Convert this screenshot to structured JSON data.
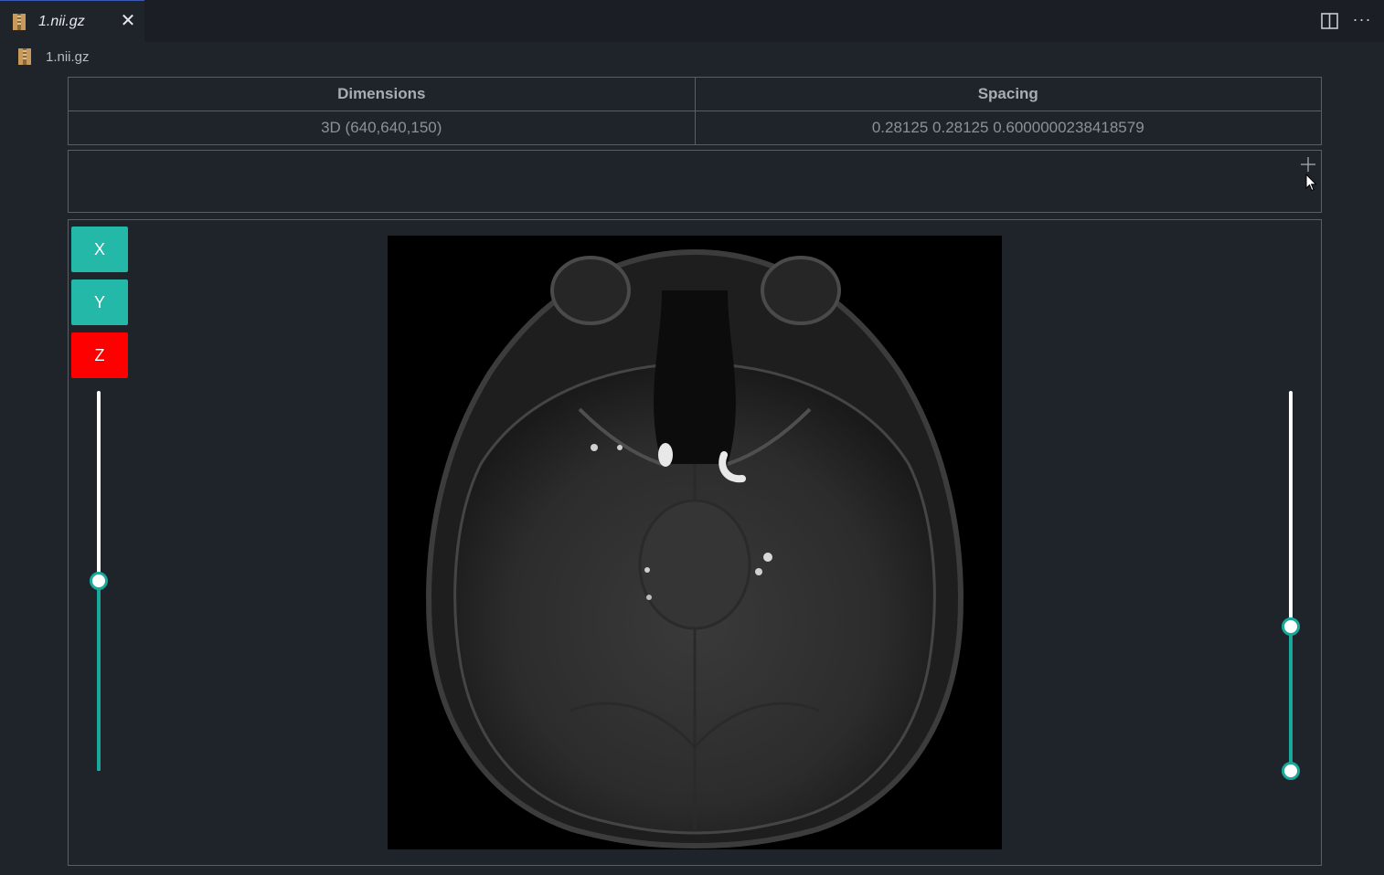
{
  "tab": {
    "title": "1.nii.gz",
    "close": "✕"
  },
  "header": {
    "more": "···"
  },
  "breadcrumb": {
    "label": "1.nii.gz"
  },
  "info_table": {
    "headers": [
      "Dimensions",
      "Spacing"
    ],
    "values": [
      "3D (640,640,150)",
      "0.28125 0.28125 0.6000000238418579"
    ]
  },
  "axis_buttons": {
    "x": {
      "label": "X",
      "color": "#23b8a8"
    },
    "y": {
      "label": "Y",
      "color": "#23b8a8"
    },
    "z": {
      "label": "Z",
      "color": "#ff0000",
      "active": true
    }
  },
  "slice_slider": {
    "fraction": 0.5
  },
  "window_slider": {
    "low": 0.0,
    "high": 0.38
  },
  "colors": {
    "accent": "#19a99b",
    "active_axis": "#ff0000",
    "background": "#1f232a"
  },
  "icons": [
    "archive-file-icon",
    "close-icon",
    "split-editor-icon",
    "more-actions-icon",
    "plus-icon",
    "mouse-cursor-icon"
  ]
}
